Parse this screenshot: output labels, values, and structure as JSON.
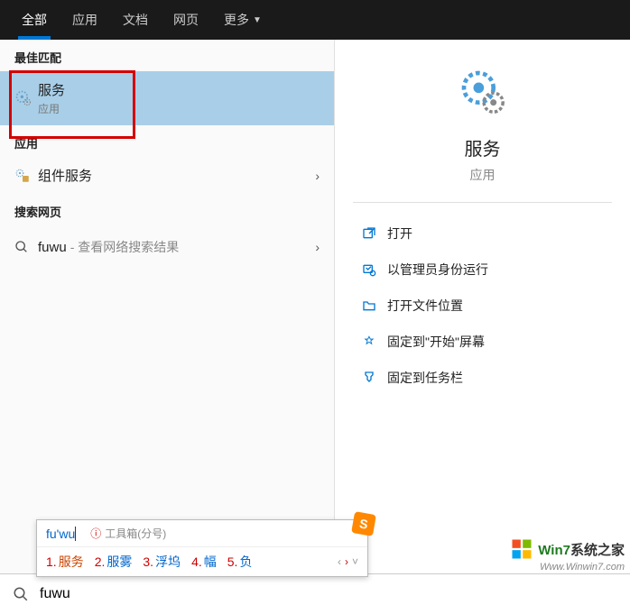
{
  "tabs": {
    "all": "全部",
    "apps": "应用",
    "docs": "文档",
    "web": "网页",
    "more": "更多"
  },
  "sections": {
    "best_match": "最佳匹配",
    "apps": "应用",
    "search_web": "搜索网页"
  },
  "best_match_item": {
    "title": "服务",
    "subtitle": "应用"
  },
  "app_item": {
    "title": "组件服务"
  },
  "web_item": {
    "query": "fuwu",
    "hint": " - 查看网络搜索结果"
  },
  "detail": {
    "title": "服务",
    "subtitle": "应用"
  },
  "actions": {
    "open": "打开",
    "run_admin": "以管理员身份运行",
    "open_location": "打开文件位置",
    "pin_start": "固定到\"开始\"屏幕",
    "pin_taskbar": "固定到任务栏"
  },
  "ime": {
    "input": "fu'wu",
    "info_icon": "ⓘ",
    "toolbox": "工具箱(分号)",
    "logo": "S",
    "candidates": [
      {
        "n": "1.",
        "w": "服务"
      },
      {
        "n": "2.",
        "w": "服雾"
      },
      {
        "n": "3.",
        "w": "浮坞"
      },
      {
        "n": "4.",
        "w": "幅"
      },
      {
        "n": "5.",
        "w": "负"
      }
    ]
  },
  "search_value": "fuwu",
  "watermark": {
    "brand_prefix": "Win7",
    "brand_suffix": "系统之家",
    "url": "Www.Winwin7.com"
  }
}
